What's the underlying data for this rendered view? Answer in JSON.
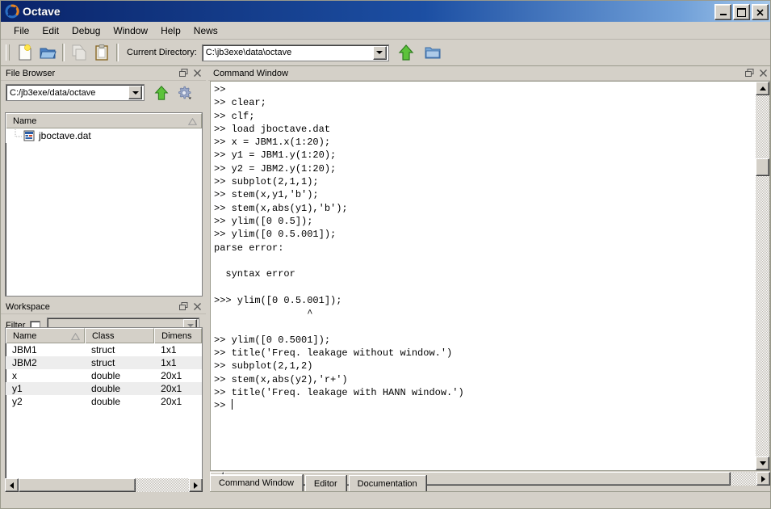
{
  "window": {
    "title": "Octave",
    "logo_icon": "octave-logo-icon",
    "minimize_label": "_",
    "maximize_label": "□",
    "close_label": "×"
  },
  "menubar": {
    "items": [
      {
        "label": "File"
      },
      {
        "label": "Edit"
      },
      {
        "label": "Debug"
      },
      {
        "label": "Window"
      },
      {
        "label": "Help"
      },
      {
        "label": "News"
      }
    ]
  },
  "toolbar": {
    "new_script_icon": "new-file-icon",
    "open_file_icon": "open-folder-icon",
    "copy_icon": "copy-icon",
    "paste_icon": "paste-clipboard-icon",
    "cwd_label": "Current Directory:",
    "cwd_value": "C:\\jb3exe\\data\\octave",
    "up_dir_icon": "green-up-arrow-icon",
    "browse_dir_icon": "blue-folder-icon"
  },
  "file_browser": {
    "title": "File Browser",
    "undock_icon": "undock-icon",
    "close_icon": "close-icon",
    "path_value": "C:/jb3exe/data/octave",
    "up_icon": "green-up-arrow-icon",
    "settings_icon": "gear-icon",
    "column_header": "Name",
    "sort_icon": "sort-ascending-icon",
    "files": [
      {
        "name": "jboctave.dat",
        "icon": "dat-file-icon"
      }
    ]
  },
  "workspace": {
    "title": "Workspace",
    "undock_icon": "undock-icon",
    "close_icon": "close-icon",
    "filter_label": "Filter",
    "filter_checked": false,
    "filter_value": "",
    "columns": [
      "Name",
      "Class",
      "Dimens"
    ],
    "sort_icon": "sort-ascending-icon",
    "rows": [
      {
        "name": "JBM1",
        "class": "struct",
        "dimension": "1x1"
      },
      {
        "name": "JBM2",
        "class": "struct",
        "dimension": "1x1"
      },
      {
        "name": "x",
        "class": "double",
        "dimension": "20x1"
      },
      {
        "name": "y1",
        "class": "double",
        "dimension": "20x1"
      },
      {
        "name": "y2",
        "class": "double",
        "dimension": "20x1"
      }
    ]
  },
  "command_window": {
    "title": "Command Window",
    "undock_icon": "undock-icon",
    "close_icon": "close-icon",
    "content": ">>\n>> clear;\n>> clf;\n>> load jboctave.dat\n>> x = JBM1.x(1:20);\n>> y1 = JBM1.y(1:20);\n>> y2 = JBM2.y(1:20);\n>> subplot(2,1,1);\n>> stem(x,y1,'b');\n>> stem(x,abs(y1),'b');\n>> ylim([0 0.5]);\n>> ylim([0 0.5.001]);\nparse error:\n\n  syntax error\n\n>>> ylim([0 0.5.001]);\n                ^\n\n>> ylim([0 0.5001]);\n>> title('Freq. leakage without window.')\n>> subplot(2,1,2)\n>> stem(x,abs(y2),'r+')\n>> title('Freq. leakage with HANN window.')\n>> "
  },
  "bottom_tabs": {
    "items": [
      {
        "label": "Command Window",
        "active": true
      },
      {
        "label": "Editor",
        "active": false
      },
      {
        "label": "Documentation",
        "active": false
      }
    ]
  },
  "colors": {
    "titlebar_start": "#0a246a",
    "titlebar_end": "#a6c8ea",
    "window_bg": "#d4d0c8",
    "text": "#000000",
    "field_bg": "#ffffff"
  }
}
